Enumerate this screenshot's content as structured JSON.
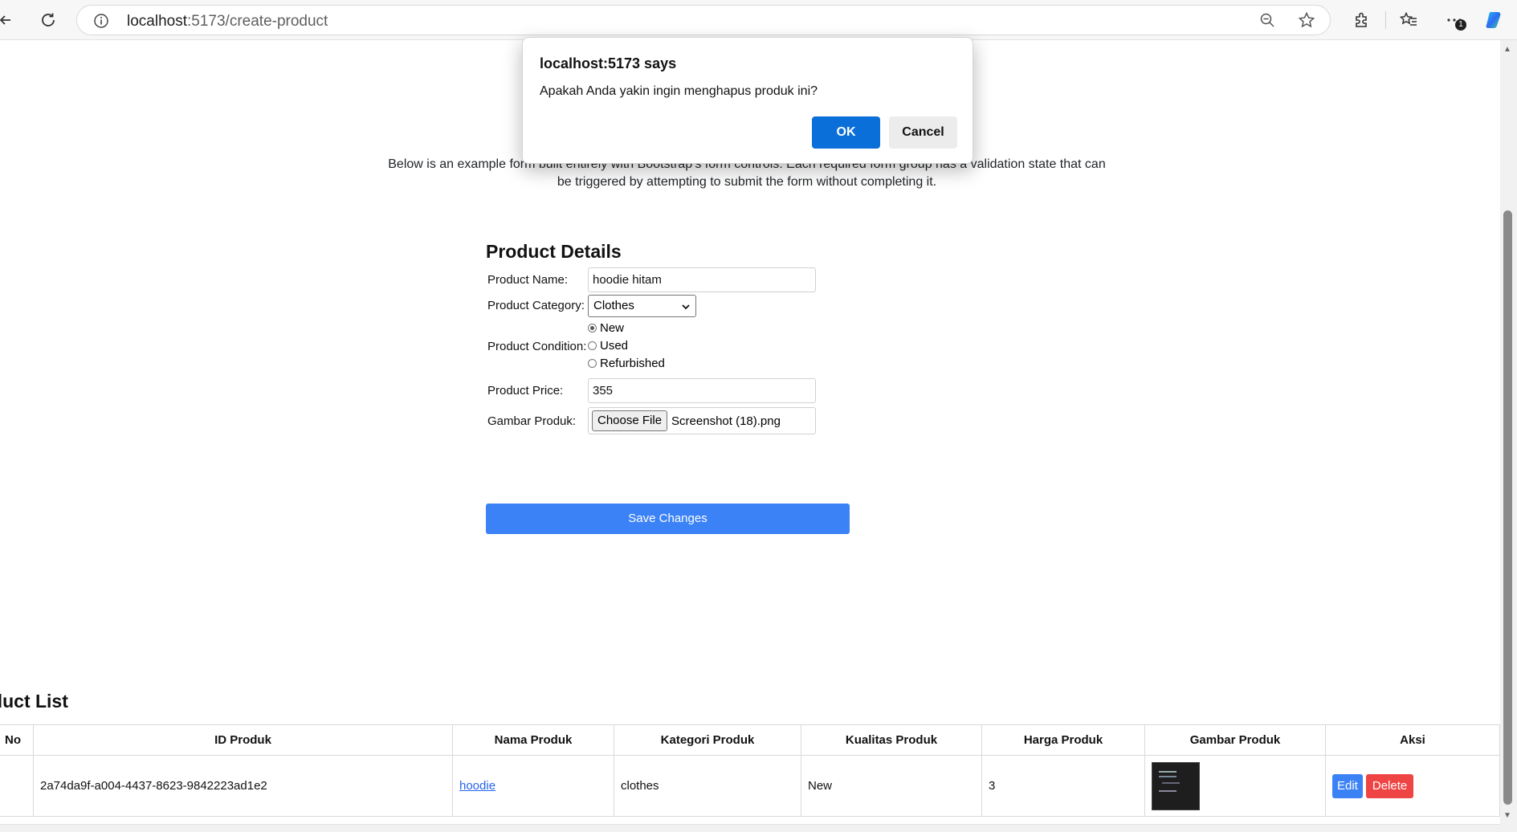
{
  "browser": {
    "url_host": "localhost",
    "url_path": ":5173/create-product",
    "menu_badge": "1"
  },
  "page": {
    "lead_text": "Below is an example form built entirely with Bootstrap’s form controls. Each required form group has a validation state that can be triggered by attempting to submit the form without completing it."
  },
  "form": {
    "title": "Product Details",
    "name_label": "Product Name:",
    "name_value": "hoodie hitam",
    "category_label": "Product Category:",
    "category_value": "Clothes",
    "condition_label": "Product Condition:",
    "conditions": [
      "New",
      "Used",
      "Refurbished"
    ],
    "condition_selected": "New",
    "price_label": "Product Price:",
    "price_value": "355",
    "image_label": "Gambar Produk:",
    "file_button": "Choose File",
    "file_name": "Screenshot (18).png",
    "save_label": "Save Changes"
  },
  "product_list": {
    "title": "oduct List",
    "headers": [
      "No",
      "ID Produk",
      "Nama Produk",
      "Kategori Produk",
      "Kualitas Produk",
      "Harga Produk",
      "Gambar Produk",
      "Aksi"
    ],
    "rows": [
      {
        "no": "",
        "id": "2a74da9f-a004-4437-8623-9842223ad1e2",
        "name": "hoodie",
        "category": "clothes",
        "quality": "New",
        "price": "3",
        "edit_label": "Edit",
        "delete_label": "Delete"
      }
    ]
  },
  "dialog": {
    "title": "localhost:5173 says",
    "message": "Apakah Anda yakin ingin menghapus produk ini?",
    "ok_label": "OK",
    "cancel_label": "Cancel"
  },
  "colors": {
    "primary": "#3b82f6",
    "danger": "#ef4444",
    "dialog_ok": "#0a6fd8"
  }
}
